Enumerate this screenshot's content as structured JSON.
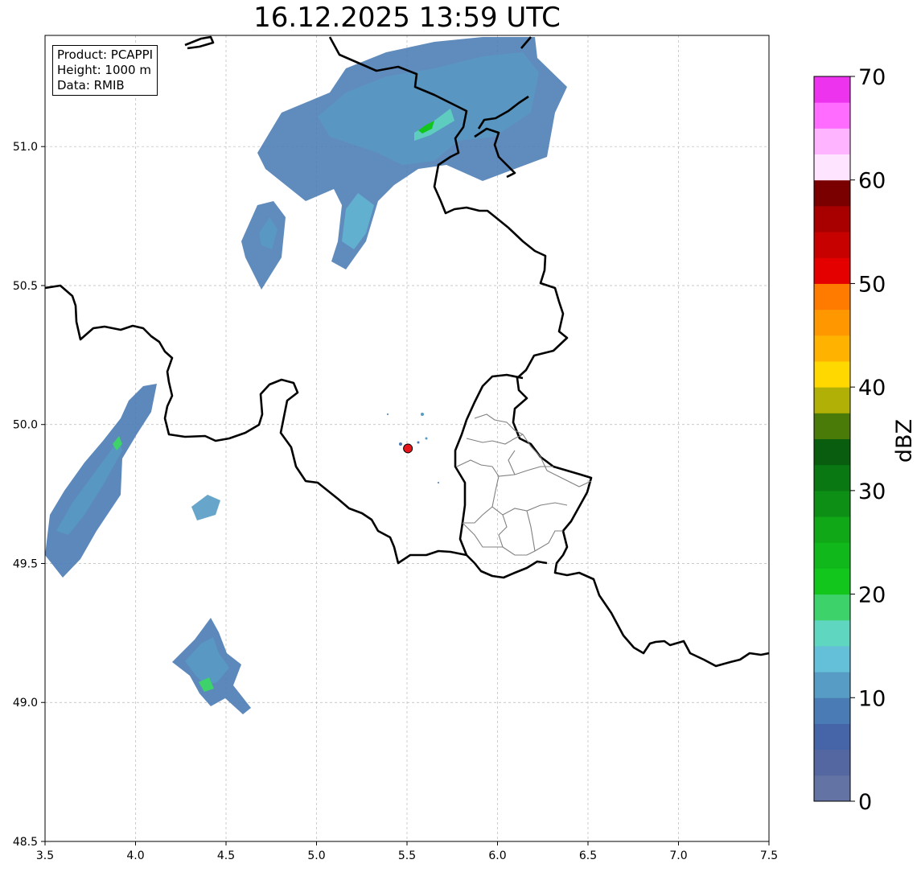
{
  "title": "16.12.2025 13:59 UTC",
  "info": {
    "product": "Product: PCAPPI",
    "height": "Height: 1000 m",
    "data": "Data: RMIB"
  },
  "map": {
    "lon_range": [
      3.5,
      7.5
    ],
    "lat_range": [
      48.5,
      51.4
    ],
    "x_ticks": [
      "3.5",
      "4.0",
      "4.5",
      "5.0",
      "5.5",
      "6.0",
      "6.5",
      "7.0",
      "7.5"
    ],
    "y_ticks": [
      "48.5",
      "49.0",
      "49.5",
      "50.0",
      "50.5",
      "51.0"
    ],
    "grid": true,
    "radar_site": {
      "lon": 5.505,
      "lat": 49.914,
      "color": "#e8151b"
    }
  },
  "colorbar": {
    "label": "dBZ",
    "range": [
      0,
      70
    ],
    "ticks": [
      "0",
      "10",
      "20",
      "30",
      "40",
      "50",
      "60",
      "70"
    ],
    "colors": [
      "#6374a4",
      "#5567a0",
      "#4664a8",
      "#4a7bb4",
      "#579cc4",
      "#63c0d8",
      "#5fd6c0",
      "#3dd26a",
      "#12c61c",
      "#11b81c",
      "#10a816",
      "#0c8f14",
      "#0a7812",
      "#085e0e",
      "#4a7a08",
      "#b0b006",
      "#ffd800",
      "#ffb300",
      "#ff9800",
      "#ff7b00",
      "#e50000",
      "#c70000",
      "#a80000",
      "#7a0000",
      "#ffe4ff",
      "#ffb4ff",
      "#ff6cff",
      "#ee33ee"
    ]
  }
}
